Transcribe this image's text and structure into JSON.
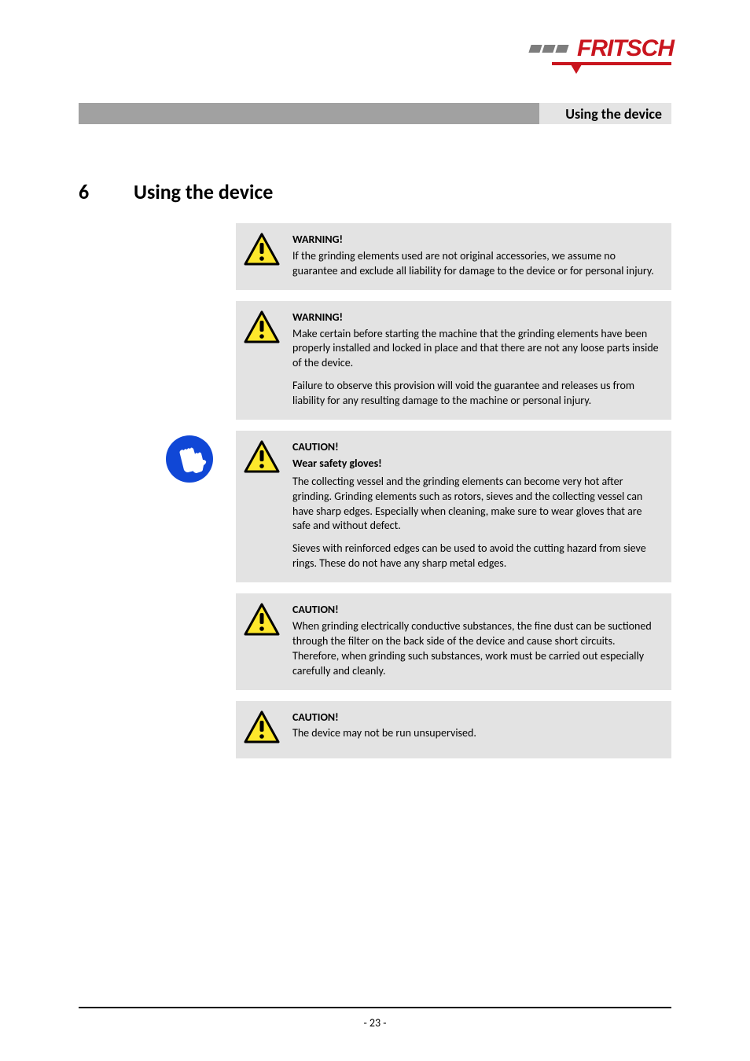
{
  "logo": {
    "brand": "FRITSCH"
  },
  "header": {
    "title": "Using the device"
  },
  "section": {
    "number": "6",
    "title": "Using the device"
  },
  "alerts": {
    "a1": {
      "title": "WARNING!",
      "p1": "If the grinding elements used are not original accessories, we assume no guarantee and exclude all liability for damage to the device or for personal injury."
    },
    "a2": {
      "title": "WARNING!",
      "p1": "Make certain before starting the machine that the grinding elements have been properly installed and locked in place and that there are not any loose parts inside of the device.",
      "p2": "Failure to observe this provision will void the guarantee and releases us from liability for any resulting damage to the machine or personal injury."
    },
    "a3": {
      "title": "CAUTION!",
      "subtitle": "Wear safety gloves!",
      "p1": "The collecting vessel and the grinding elements can become very hot after grinding. Grinding elements such as rotors, sieves and the collecting vessel can have sharp edges. Especially when cleaning, make sure to wear gloves that are safe and without defect.",
      "p2": "Sieves with reinforced edges can be used to avoid the cutting hazard from sieve rings. These do not have any sharp metal edges."
    },
    "a4": {
      "title": "CAUTION!",
      "p1": "When grinding electrically conductive substances, the fine dust can be suctioned through the filter on the back side of the device and cause short circuits. Therefore, when grinding such substances, work must be carried out especially carefully and cleanly."
    },
    "a5": {
      "title": "CAUTION!",
      "p1": "The device may not be run unsupervised."
    }
  },
  "footer": {
    "page": "- 23 -"
  }
}
